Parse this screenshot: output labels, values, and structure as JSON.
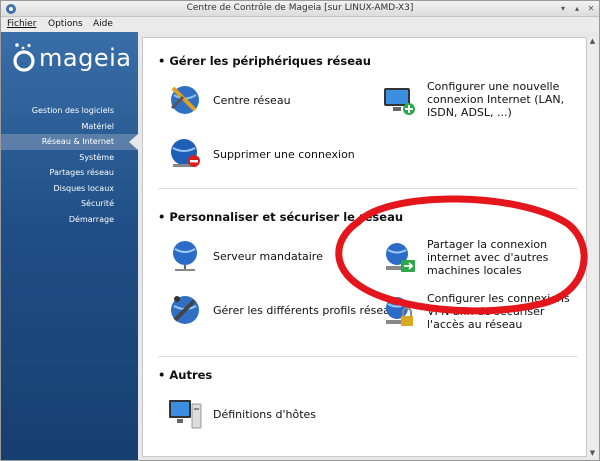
{
  "window": {
    "title": "Centre de Contrôle de Mageia  [sur LINUX-AMD-X3]"
  },
  "menubar": {
    "file": "Fichier",
    "options": "Options",
    "help": "Aide"
  },
  "logo": {
    "text": "mageia"
  },
  "sidebar": {
    "items": [
      {
        "label": "Gestion des logiciels",
        "active": false
      },
      {
        "label": "Matériel",
        "active": false
      },
      {
        "label": "Réseau & Internet",
        "active": true
      },
      {
        "label": "Système",
        "active": false
      },
      {
        "label": "Partages réseau",
        "active": false
      },
      {
        "label": "Disques locaux",
        "active": false
      },
      {
        "label": "Sécurité",
        "active": false
      },
      {
        "label": "Démarrage",
        "active": false
      }
    ]
  },
  "sections": [
    {
      "title": "• Gérer les périphériques réseau",
      "items": [
        {
          "label": "Centre réseau",
          "icon": "network-center-icon"
        },
        {
          "label": "Configurer une nouvelle connexion Internet (LAN, ISDN, ADSL, ...)",
          "icon": "new-connection-icon"
        },
        {
          "label": "Supprimer une connexion",
          "icon": "remove-connection-icon"
        }
      ]
    },
    {
      "title": "• Personnaliser et sécuriser le réseau",
      "items": [
        {
          "label": "Serveur mandataire",
          "icon": "proxy-icon"
        },
        {
          "label": "Partager la connexion internet avec d'autres machines locales",
          "icon": "share-connection-icon"
        },
        {
          "label": "Gérer les différents profils réseau",
          "icon": "profiles-icon"
        },
        {
          "label": "Configurer les connexions VPN afin de sécuriser l'accès au réseau",
          "icon": "vpn-icon"
        }
      ]
    },
    {
      "title": "• Autres",
      "items": [
        {
          "label": "Définitions d'hôtes",
          "icon": "hosts-icon"
        }
      ]
    }
  ],
  "colors": {
    "sidebar_top": "#3a6ea8",
    "sidebar_bottom": "#163f70",
    "highlight": "#5b7fa8",
    "annotation": "#e4161c"
  }
}
